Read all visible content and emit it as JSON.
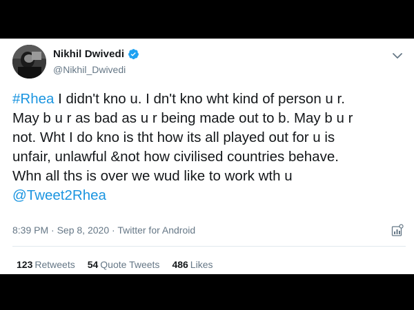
{
  "author": {
    "display_name": "Nikhil Dwivedi",
    "handle": "@Nikhil_Dwivedi",
    "verified": true,
    "avatar_icon": "profile-photo"
  },
  "tweet": {
    "hashtag": "#Rhea",
    "line1_rest": " I didn't kno u. I dn't kno wht kind of person u r.",
    "line2": "May b u r as bad as u r being made out to b. May b u r",
    "line3": "not. Wht I do kno is tht how its all played out for u is",
    "line4": "unfair, unlawful &not how civilised countries behave.",
    "line5": "Whn all ths is over we wud like to work wth u",
    "mention": "@Tweet2Rhea"
  },
  "meta": {
    "time": "8:39 PM",
    "date": "Sep 8, 2020",
    "source": "Twitter for Android",
    "separator": " · "
  },
  "stats": {
    "retweets_count": "123",
    "retweets_label": "Retweets",
    "quotes_count": "54",
    "quotes_label": "Quote Tweets",
    "likes_count": "486",
    "likes_label": "Likes"
  },
  "colors": {
    "link": "#1b95e0",
    "secondary": "#657786",
    "text": "#14171a",
    "verified": "#1da1f2"
  },
  "icons": {
    "verified": "verified-badge-icon",
    "menu": "chevron-down-icon",
    "analytics": "analytics-icon"
  }
}
